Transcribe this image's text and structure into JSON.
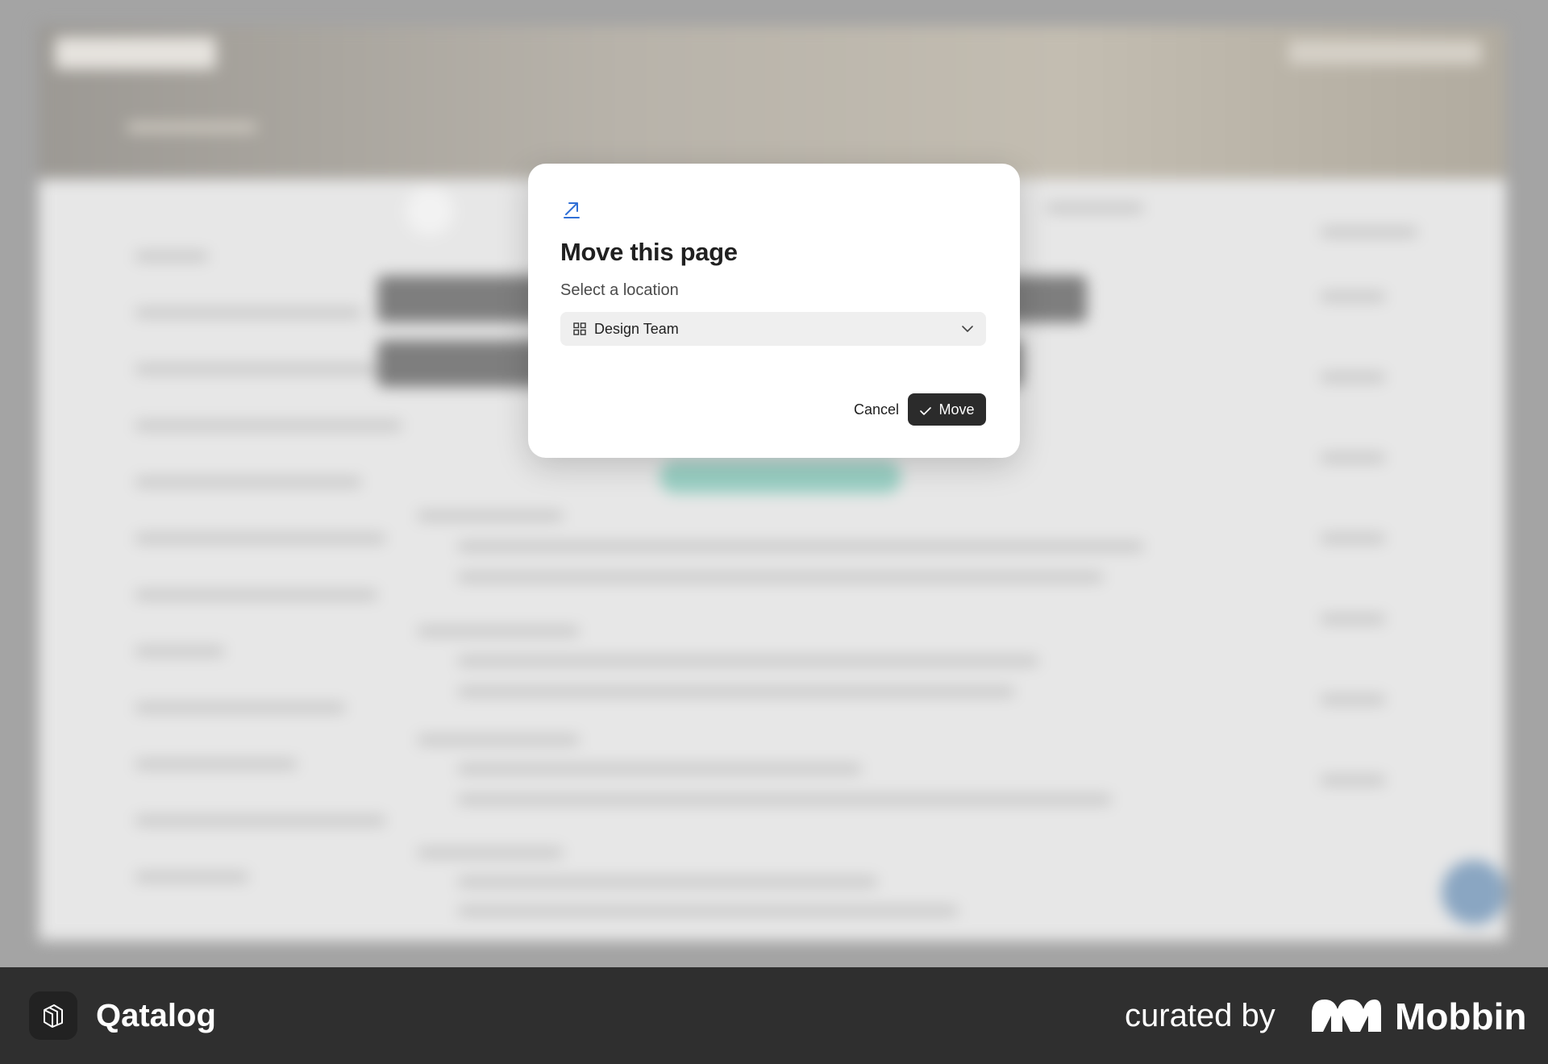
{
  "dialog": {
    "title": "Move this page",
    "subtitle": "Select a location",
    "location_selected": "Design Team",
    "cancel_label": "Cancel",
    "move_label": "Move"
  },
  "footer": {
    "app_name": "Qatalog",
    "curated_by": "curated by",
    "brand": "Mobbin"
  },
  "colors": {
    "accent_icon": "#2f6fd6",
    "primary_button": "#2b2b2b",
    "select_background": "#efefef",
    "footer_background": "#2f2f2f"
  },
  "icons": {
    "dialog": "arrow-up-right-icon",
    "select": "grid-icon",
    "select_caret": "chevron-down-icon",
    "move": "check-icon",
    "app": "qatalog-logo-icon",
    "brand": "mobbin-logo-icon"
  }
}
